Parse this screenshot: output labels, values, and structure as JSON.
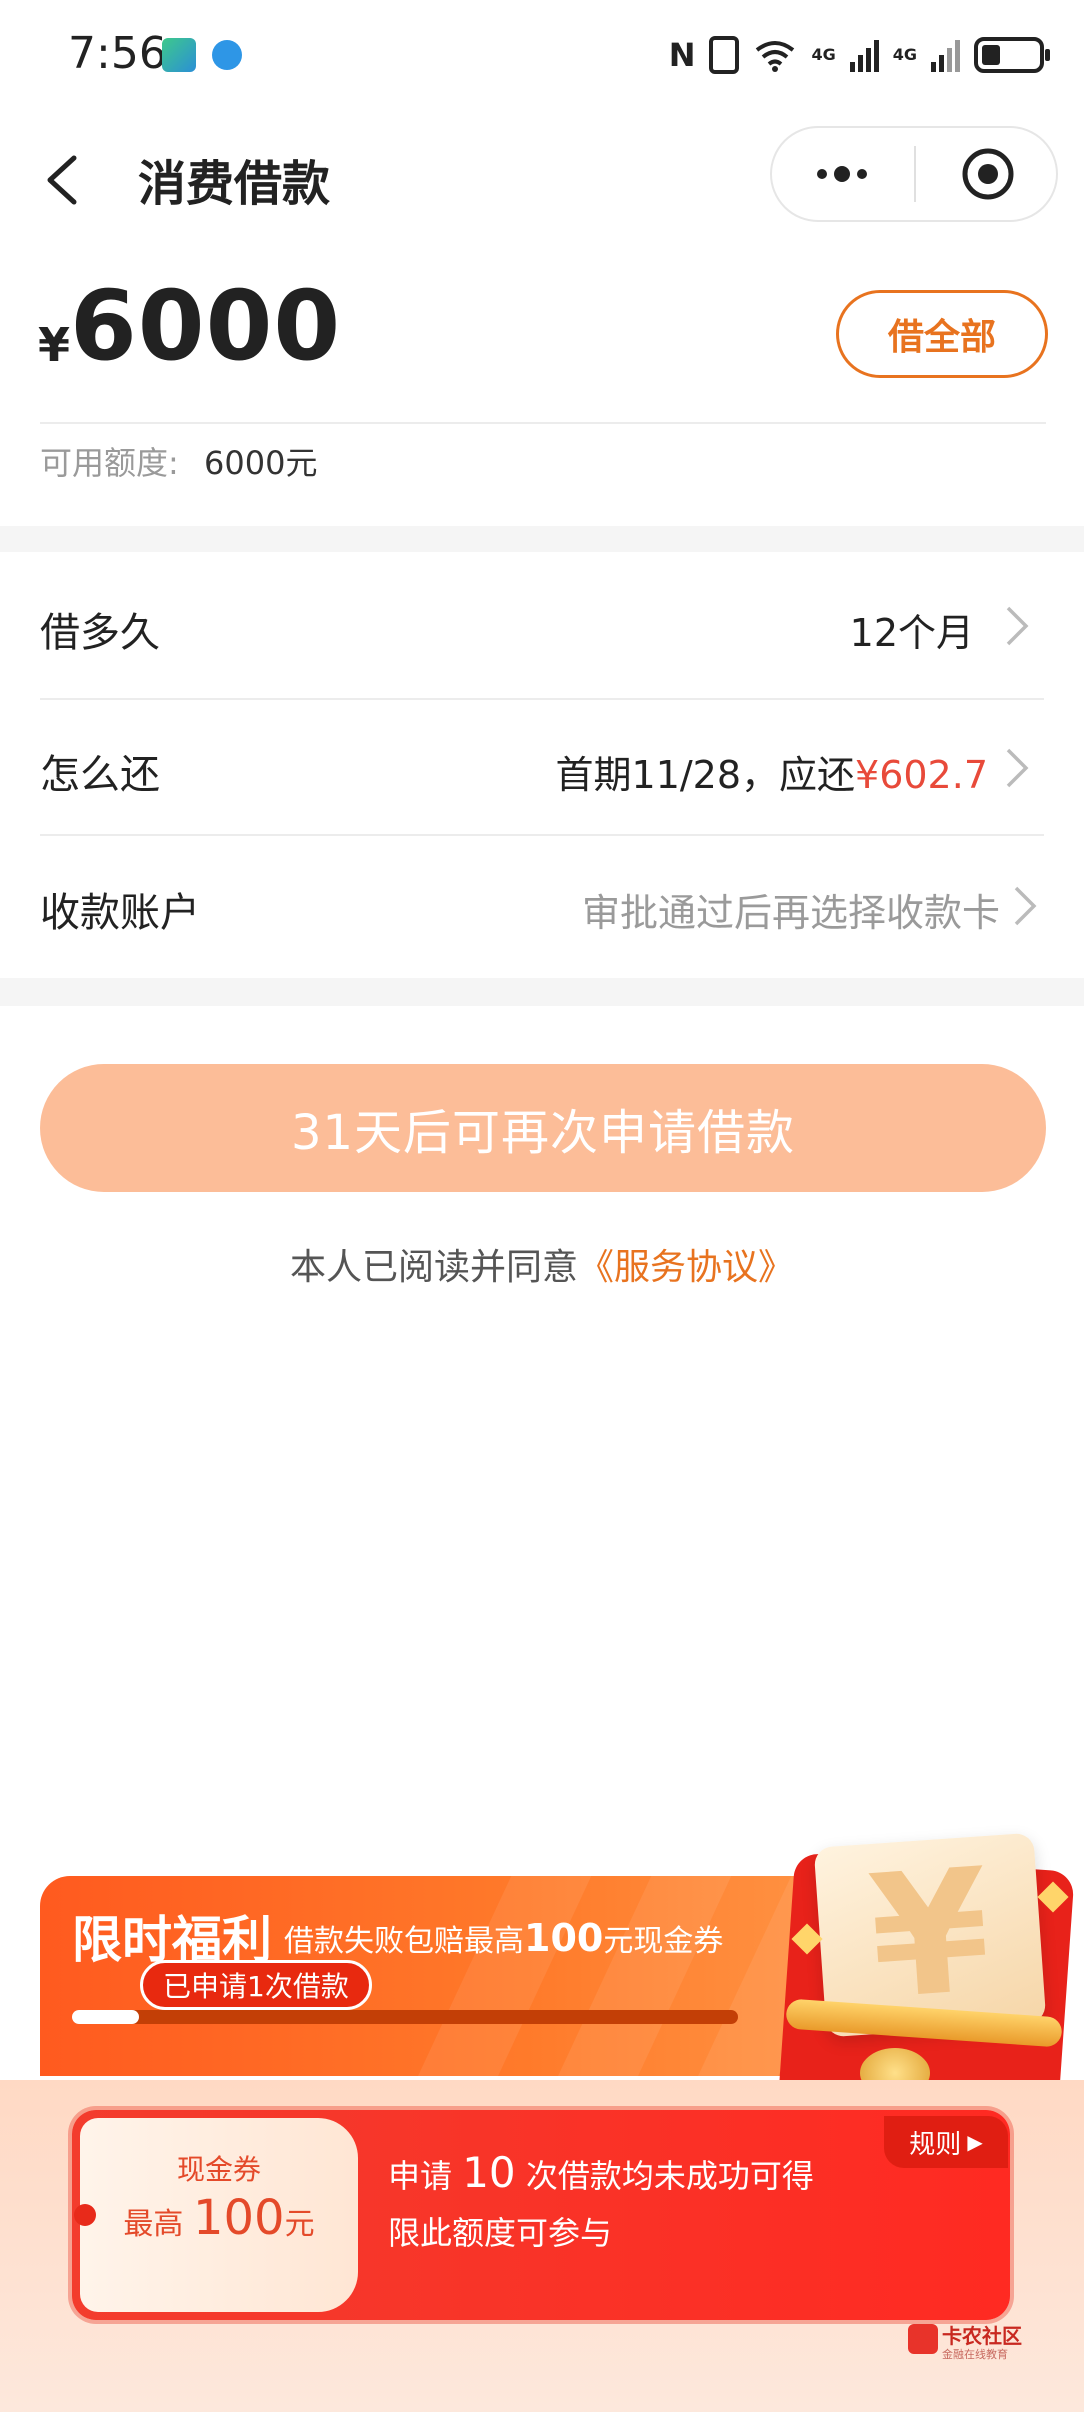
{
  "status_bar": {
    "time": "7:56",
    "nfc": "N",
    "network_1": "4G",
    "network_2": "4G",
    "wifi_mark": "6"
  },
  "nav": {
    "title": "消费借款",
    "back_icon": "chevron-left-icon",
    "more_icon": "more-dots-icon",
    "close_icon": "target-close-icon"
  },
  "amount": {
    "currency": "¥",
    "value": "6000",
    "borrow_all_label": "借全部",
    "available_label": "可用额度:",
    "available_value": "6000元"
  },
  "rows": [
    {
      "label": "借多久",
      "value": "12个月"
    },
    {
      "label": "怎么还",
      "value_prefix": "首期11/28，应还",
      "value_highlight": "¥602.7"
    },
    {
      "label": "收款账户",
      "value": "审批通过后再选择收款卡"
    }
  ],
  "apply": {
    "button_label": "31天后可再次申请借款",
    "agreement_text": "本人已阅读并同意",
    "agreement_link": "《服务协议》"
  },
  "promo": {
    "title": "限时福利",
    "subtitle_prefix": "借款失败包赔最高",
    "subtitle_amount": "100",
    "subtitle_suffix": "元现金券",
    "applied_badge": "已申请1次借款",
    "progress": 0.1,
    "coupon": {
      "type": "现金券",
      "amount_prefix": "最高 ",
      "amount": "100",
      "amount_suffix": "元",
      "line1_prefix": "申请 ",
      "line1_count": "10",
      "line1_suffix": " 次借款均未成功可得",
      "line2": "限此额度可参与",
      "rules_label": "规则"
    },
    "yen_symbol": "¥"
  },
  "watermark": {
    "title": "卡农社区",
    "subtitle": "金融在线教育"
  },
  "colors": {
    "accent_orange": "#e8731f",
    "highlight_red": "#e84a3a",
    "button_disabled": "#fcbd98"
  }
}
